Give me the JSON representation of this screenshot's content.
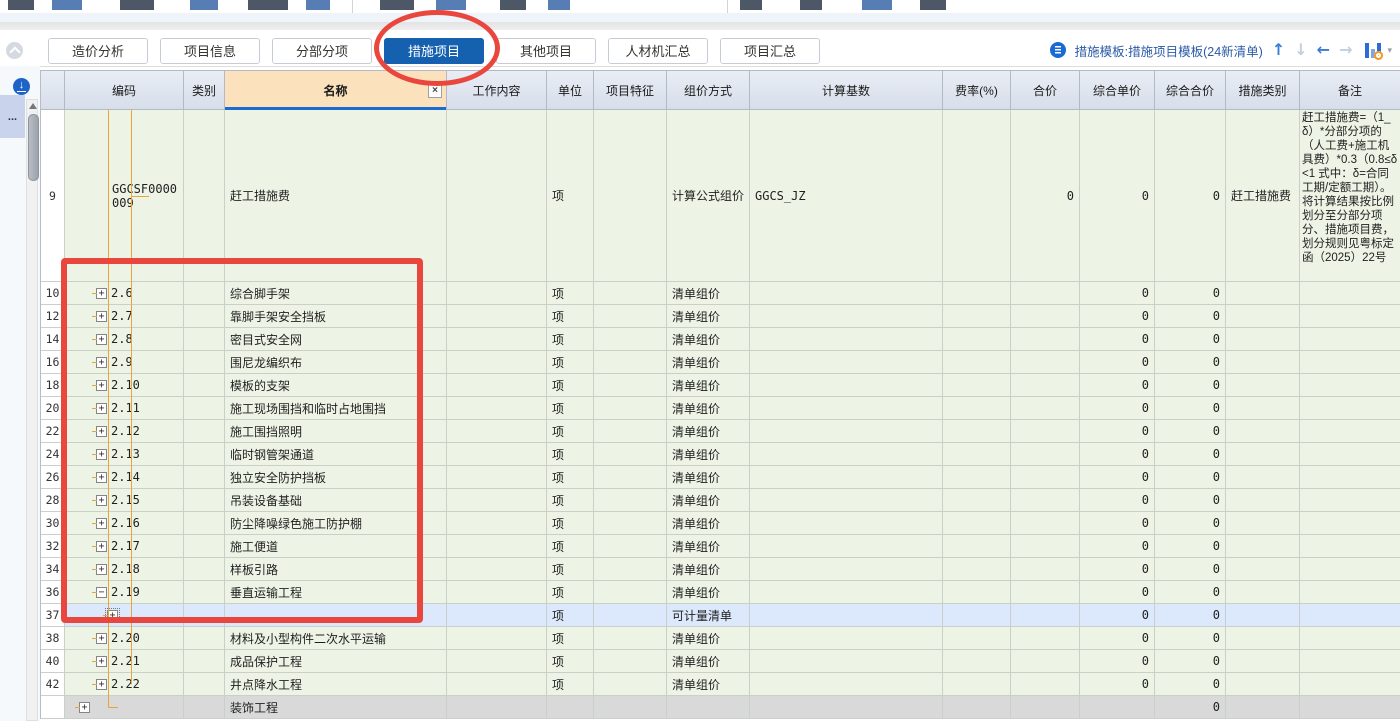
{
  "tabs": [
    {
      "label": "造价分析",
      "active": false
    },
    {
      "label": "项目信息",
      "active": false
    },
    {
      "label": "分部分项",
      "active": false
    },
    {
      "label": "措施项目",
      "active": true
    },
    {
      "label": "其他项目",
      "active": false
    },
    {
      "label": "人材机汇总",
      "active": false
    },
    {
      "label": "项目汇总",
      "active": false
    }
  ],
  "toolbar_right": {
    "template_label": "措施模板:措施项目模板(24新清单)",
    "icons": {
      "up": "↑",
      "down": "↓",
      "left": "←",
      "right": "→",
      "caret": "▾"
    }
  },
  "sidebar": {
    "collapsed_item_label": "...",
    "download_icon_glyph": "↓"
  },
  "name_header_close_glyph": "×",
  "table": {
    "columns": [
      {
        "key": "code",
        "label": "编码"
      },
      {
        "key": "cat",
        "label": "类别"
      },
      {
        "key": "name",
        "label": "名称"
      },
      {
        "key": "work",
        "label": "工作内容"
      },
      {
        "key": "unit",
        "label": "单位"
      },
      {
        "key": "feat",
        "label": "项目特征"
      },
      {
        "key": "pricing",
        "label": "组价方式"
      },
      {
        "key": "base",
        "label": "计算基数"
      },
      {
        "key": "rate",
        "label": "费率(%)"
      },
      {
        "key": "total",
        "label": "合价"
      },
      {
        "key": "unitPrice",
        "label": "综合单价"
      },
      {
        "key": "totalPrice",
        "label": "综合合价"
      },
      {
        "key": "category",
        "label": "措施类别"
      },
      {
        "key": "remark",
        "label": "备注"
      }
    ],
    "rows": [
      {
        "num": "9",
        "code": "GGCSF0000009",
        "name": "赶工措施费",
        "unit": "项",
        "pricing": "计算公式组价",
        "base": "GGCS_JZ",
        "total": "0",
        "unitPrice": "0",
        "totalPrice": "0",
        "category": "赶工措施费",
        "remark": "赶工措施费=（1_δ）*分部分项的（人工费+施工机具费）*0.3（0.8≤δ<1 式中：δ=合同工期/定额工期）。将计算结果按比例划分至分部分项分、措施项目费，划分规则见粤标定函（2025）22号",
        "tall": true
      },
      {
        "num": "10",
        "expand": "+",
        "code": "2.6",
        "name": "综合脚手架",
        "unit": "项",
        "pricing": "清单组价",
        "unitPrice": "0",
        "totalPrice": "0"
      },
      {
        "num": "12",
        "expand": "+",
        "code": "2.7",
        "name": "靠脚手架安全挡板",
        "unit": "项",
        "pricing": "清单组价",
        "unitPrice": "0",
        "totalPrice": "0"
      },
      {
        "num": "14",
        "expand": "+",
        "code": "2.8",
        "name": "密目式安全网",
        "unit": "项",
        "pricing": "清单组价",
        "unitPrice": "0",
        "totalPrice": "0"
      },
      {
        "num": "16",
        "expand": "+",
        "code": "2.9",
        "name": "围尼龙编织布",
        "unit": "项",
        "pricing": "清单组价",
        "unitPrice": "0",
        "totalPrice": "0"
      },
      {
        "num": "18",
        "expand": "+",
        "code": "2.10",
        "name": "模板的支架",
        "unit": "项",
        "pricing": "清单组价",
        "unitPrice": "0",
        "totalPrice": "0"
      },
      {
        "num": "20",
        "expand": "+",
        "code": "2.11",
        "name": "施工现场围挡和临时占地围挡",
        "unit": "项",
        "pricing": "清单组价",
        "unitPrice": "0",
        "totalPrice": "0"
      },
      {
        "num": "22",
        "expand": "+",
        "code": "2.12",
        "name": "施工围挡照明",
        "unit": "项",
        "pricing": "清单组价",
        "unitPrice": "0",
        "totalPrice": "0"
      },
      {
        "num": "24",
        "expand": "+",
        "code": "2.13",
        "name": "临时钢管架通道",
        "unit": "项",
        "pricing": "清单组价",
        "unitPrice": "0",
        "totalPrice": "0"
      },
      {
        "num": "26",
        "expand": "+",
        "code": "2.14",
        "name": "独立安全防护挡板",
        "unit": "项",
        "pricing": "清单组价",
        "unitPrice": "0",
        "totalPrice": "0"
      },
      {
        "num": "28",
        "expand": "+",
        "code": "2.15",
        "name": "吊装设备基础",
        "unit": "项",
        "pricing": "清单组价",
        "unitPrice": "0",
        "totalPrice": "0"
      },
      {
        "num": "30",
        "expand": "+",
        "code": "2.16",
        "name": "防尘降噪绿色施工防护棚",
        "unit": "项",
        "pricing": "清单组价",
        "unitPrice": "0",
        "totalPrice": "0"
      },
      {
        "num": "32",
        "expand": "+",
        "code": "2.17",
        "name": "施工便道",
        "unit": "项",
        "pricing": "清单组价",
        "unitPrice": "0",
        "totalPrice": "0"
      },
      {
        "num": "34",
        "expand": "+",
        "code": "2.18",
        "name": "样板引路",
        "unit": "项",
        "pricing": "清单组价",
        "unitPrice": "0",
        "totalPrice": "0"
      },
      {
        "num": "36",
        "expand": "−",
        "code": "2.19",
        "name": "垂直运输工程",
        "unit": "项",
        "pricing": "清单组价",
        "unitPrice": "0",
        "totalPrice": "0"
      },
      {
        "num": "37",
        "expand": "+",
        "indent": "child",
        "selected": true,
        "unit": "项",
        "pricing": "可计量清单",
        "unitPrice": "0",
        "totalPrice": "0"
      },
      {
        "num": "38",
        "expand": "+",
        "code": "2.20",
        "name": "材料及小型构件二次水平运输",
        "unit": "项",
        "pricing": "清单组价",
        "unitPrice": "0",
        "totalPrice": "0"
      },
      {
        "num": "40",
        "expand": "+",
        "code": "2.21",
        "name": "成品保护工程",
        "unit": "项",
        "pricing": "清单组价",
        "unitPrice": "0",
        "totalPrice": "0"
      },
      {
        "num": "42",
        "expand": "+",
        "code": "2.22",
        "name": "井点降水工程",
        "unit": "项",
        "pricing": "清单组价",
        "unitPrice": "0",
        "totalPrice": "0"
      },
      {
        "num": "",
        "expand": "+",
        "indent": "outer",
        "gray": true,
        "name": "装饰工程",
        "totalPrice": "0"
      }
    ]
  }
}
